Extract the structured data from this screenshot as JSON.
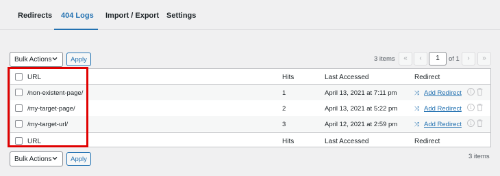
{
  "tabs": [
    {
      "label": "Redirects",
      "active": false
    },
    {
      "label": "404 Logs",
      "active": true
    },
    {
      "label": "Import / Export",
      "active": false
    },
    {
      "label": "Settings",
      "active": false
    }
  ],
  "top_controls": {
    "bulk_actions": "Bulk Actions",
    "apply": "Apply",
    "items_count": "3 items",
    "pagination": {
      "first": "«",
      "prev": "‹",
      "current_page": "1",
      "of": "of 1",
      "next": "›",
      "last": "»"
    }
  },
  "table": {
    "columns": {
      "url": "URL",
      "hits": "Hits",
      "last_accessed": "Last Accessed",
      "redirect": "Redirect"
    },
    "rows": [
      {
        "url": "/non-existent-page/",
        "hits": "1",
        "last_accessed": "April 13, 2021 at 7:11 pm",
        "action": "Add Redirect"
      },
      {
        "url": "/my-target-page/",
        "hits": "2",
        "last_accessed": "April 13, 2021 at 5:22 pm",
        "action": "Add Redirect"
      },
      {
        "url": "/my-target-url/",
        "hits": "3",
        "last_accessed": "April 12, 2021 at 2:59 pm",
        "action": "Add Redirect"
      }
    ]
  },
  "bottom_controls": {
    "bulk_actions": "Bulk Actions",
    "apply": "Apply",
    "items_count": "3 items"
  },
  "colors": {
    "accent": "#2271b1",
    "highlight": "#e00000"
  },
  "icons": [
    "chevron-down-icon",
    "shuffle-icon",
    "info-icon",
    "trash-icon"
  ]
}
